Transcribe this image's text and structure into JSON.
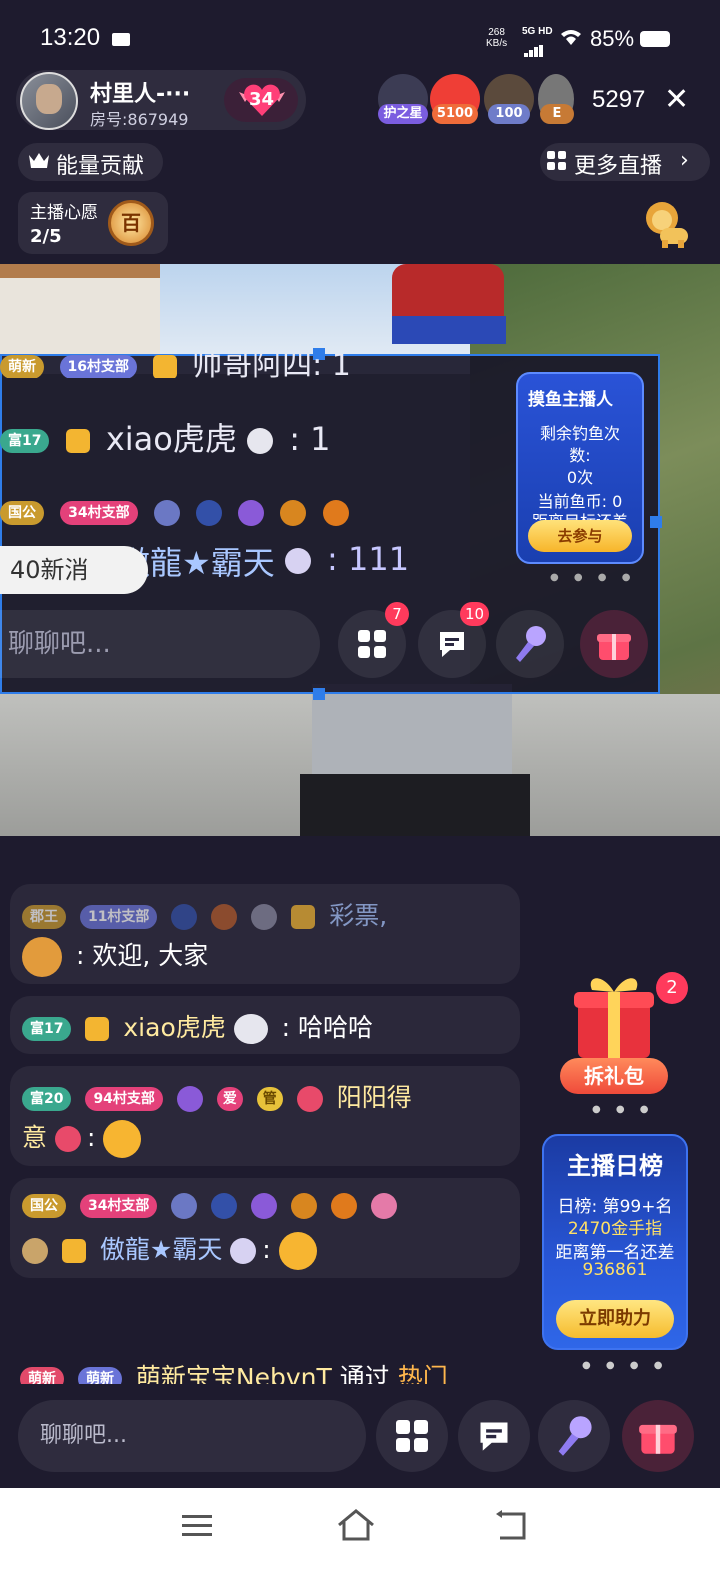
{
  "status_bar": {
    "time": "13:20",
    "net_speed_value": "268",
    "net_speed_unit": "KB/s",
    "network": "5G HD",
    "battery": "85%"
  },
  "header": {
    "host_name": "村里人-···",
    "room_no": "房号:867949",
    "heart_count": "34",
    "fans": [
      {
        "badge": "护之星",
        "color": "#7b5de0"
      },
      {
        "badge": "5100",
        "color": "#ef6c3a"
      },
      {
        "badge": "100",
        "color": "#6f7cc9"
      },
      {
        "badge": "E",
        "color": "#c77a35"
      }
    ],
    "viewer_count": "5297"
  },
  "toolbar": {
    "energy_label": "能量贡献",
    "more_live_label": "更多直播"
  },
  "wish": {
    "title": "主播心愿",
    "progress": "2/5",
    "badge_text": "百"
  },
  "overlay": {
    "line1_tag_a": "萌新",
    "line1_tag_b": "16村支部",
    "line1_text": "帅哥阿四: 1",
    "line2_tag": "富17",
    "line2_name": "xiao虎虎",
    "line2_msg": ": 1",
    "line3_tag_a": "国公",
    "line3_tag_b": "34村支部",
    "line4_name": "傲龍★霸天",
    "line4_msg": ": 111",
    "new_messages": "40新消",
    "input_placeholder": "聊聊吧...",
    "badge_apps": "7",
    "badge_msgs": "10",
    "fish": {
      "title": "摸鱼主播人",
      "line1": "剩余钓鱼次",
      "line2": "数:",
      "line3": "0次",
      "line4": "当前鱼币: 0",
      "line5": "距离目标还差",
      "button": "去参与"
    }
  },
  "chat": [
    {
      "tag_a": "郡王",
      "tag_b": "11村支部",
      "name": "彩票,",
      "msg": ": 欢迎, 大家"
    },
    {
      "tag_a": "富17",
      "name": "xiao虎虎",
      "msg": ": 哈哈哈"
    },
    {
      "tag_a": "富20",
      "tag_b": "94村支部",
      "tag_c": "爱",
      "tag_d": "管",
      "name": "阳阳得",
      "name2": "意"
    },
    {
      "tag_a": "国公",
      "tag_b": "34村支部",
      "name": "傲龍★霸天"
    },
    {
      "tag_a": "萌新",
      "tag_b": "萌新",
      "name": "萌新宝宝NebvnT",
      "msg": "通过",
      "hot": "热门"
    }
  ],
  "gift": {
    "badge": "2",
    "label": "拆礼包"
  },
  "rank": {
    "title": "主播日榜",
    "line1": "日榜: 第99+名",
    "line2": "2470金手指",
    "line3": "距离第一名还差",
    "line4": "936861",
    "button": "立即助力"
  },
  "bottom": {
    "input_placeholder": "聊聊吧..."
  },
  "colors": {
    "background": "#1e1b2e",
    "accent_blue": "#2f7dea",
    "gift_red": "#ef4a3a"
  }
}
